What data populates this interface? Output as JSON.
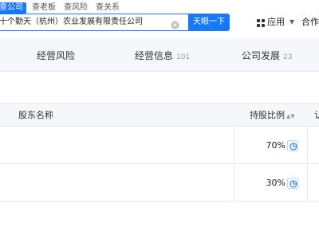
{
  "search": {
    "tabs": [
      {
        "label": "查公司",
        "active": true
      },
      {
        "label": "查老板",
        "active": false
      },
      {
        "label": "查风险",
        "active": false
      },
      {
        "label": "查关系",
        "active": false
      }
    ],
    "value": "十个勤天（杭州）农业发展有限责任公司",
    "button_label": "天眼一下"
  },
  "header": {
    "apps_label": "应用",
    "cooperate_label": "合作"
  },
  "nav_tabs": [
    {
      "label": "经营风险",
      "count": ""
    },
    {
      "label": "经营信息",
      "count": "101"
    },
    {
      "label": "公司发展",
      "count": "23"
    }
  ],
  "table": {
    "headers": {
      "name": "股东名称",
      "ratio": "持股比例"
    },
    "rows": [
      {
        "name": "",
        "ratio": "70%"
      },
      {
        "name": "",
        "ratio": "30%"
      }
    ]
  },
  "colors": {
    "accent": "#1677ff"
  }
}
